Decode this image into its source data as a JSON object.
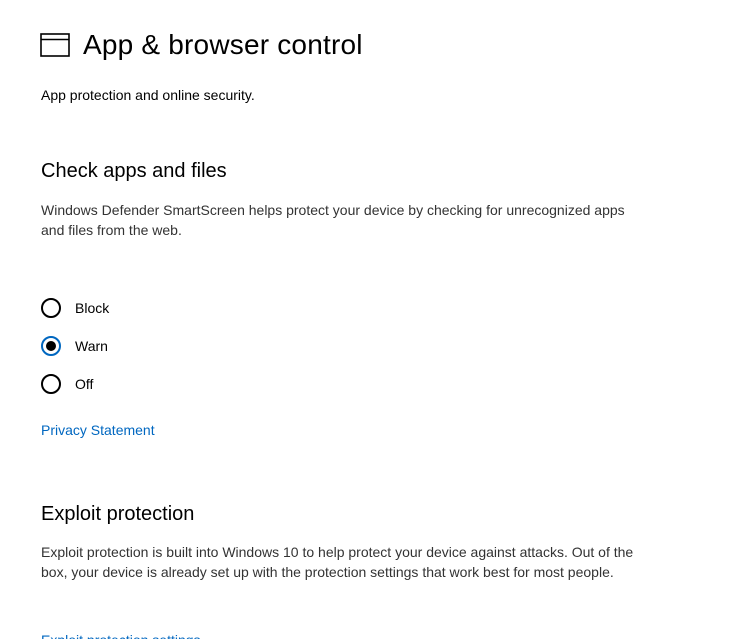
{
  "header": {
    "icon": "app-browser-window-icon",
    "title": "App & browser control",
    "subtitle": "App protection and online security."
  },
  "check_apps": {
    "title": "Check apps and files",
    "description": "Windows Defender SmartScreen helps protect your device by checking for unrecognized apps and files from the web.",
    "options": [
      {
        "label": "Block",
        "checked": false
      },
      {
        "label": "Warn",
        "checked": true
      },
      {
        "label": "Off",
        "checked": false
      }
    ],
    "privacy_link": "Privacy Statement"
  },
  "exploit": {
    "title": "Exploit protection",
    "description": "Exploit protection is built into Windows 10 to help protect your device against attacks.  Out of the box, your device is already set up with the protection settings that work best for most people.",
    "settings_link": "Exploit protection settings"
  },
  "colors": {
    "accent": "#0067c0",
    "text": "#000000",
    "secondary_text": "#333333",
    "background": "#ffffff"
  }
}
